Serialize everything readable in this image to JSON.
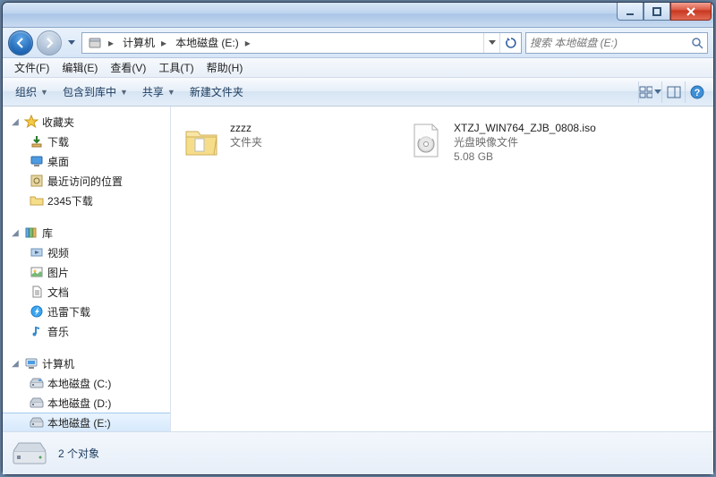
{
  "titlebar": {
    "min": "",
    "max": "",
    "close": ""
  },
  "nav": {
    "seg_computer": "计算机",
    "seg_drive": "本地磁盘 (E:)",
    "search_placeholder": "搜索 本地磁盘 (E:)"
  },
  "menu": {
    "file": "文件(F)",
    "edit": "编辑(E)",
    "view": "查看(V)",
    "tools": "工具(T)",
    "help": "帮助(H)"
  },
  "toolbar": {
    "organize": "组织",
    "include": "包含到库中",
    "share": "共享",
    "newfolder": "新建文件夹"
  },
  "side": {
    "favorites": "收藏夹",
    "downloads": "下载",
    "desktop": "桌面",
    "recent": "最近访问的位置",
    "dl2345": "2345下载",
    "libraries": "库",
    "videos": "视频",
    "pictures": "图片",
    "documents": "文档",
    "xunlei": "迅雷下载",
    "music": "音乐",
    "computer": "计算机",
    "driveC": "本地磁盘 (C:)",
    "driveD": "本地磁盘 (D:)",
    "driveE": "本地磁盘 (E:)"
  },
  "items": [
    {
      "name": "zzzz",
      "type": "文件夹",
      "kind": "folder"
    },
    {
      "name": "XTZJ_WIN764_ZJB_0808.iso",
      "type": "光盘映像文件",
      "size": "5.08 GB",
      "kind": "iso"
    }
  ],
  "status": {
    "text": "2 个对象"
  }
}
